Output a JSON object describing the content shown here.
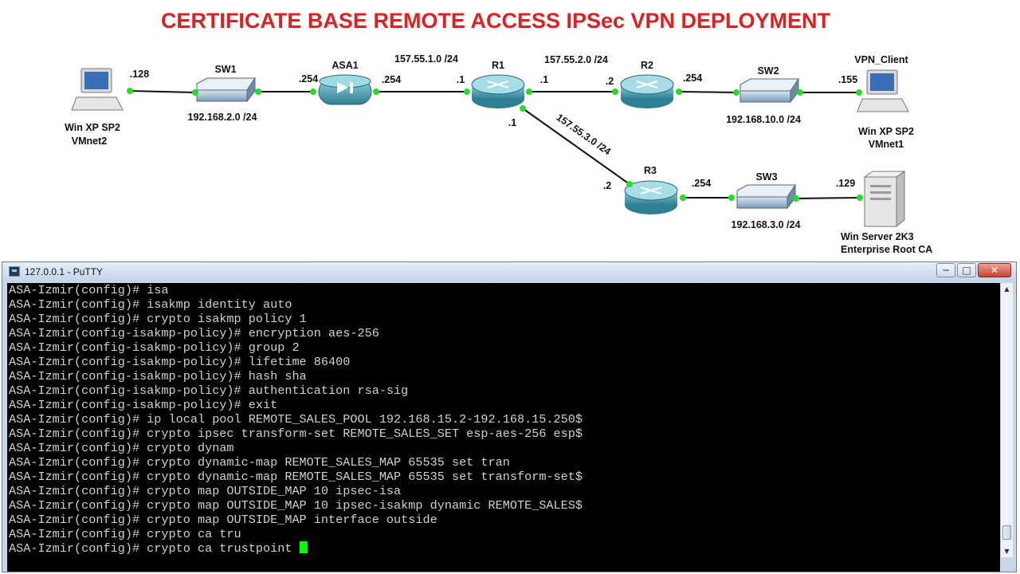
{
  "diagram": {
    "title": "CERTIFICATE BASE REMOTE ACCESS IPSec VPN DEPLOYMENT",
    "devices": {
      "sw1": "SW1",
      "asa1": "ASA1",
      "r1": "R1",
      "r2": "R2",
      "r3": "R3",
      "sw2": "SW2",
      "sw3": "SW3",
      "vpn_client": "VPN_Client"
    },
    "hosts": {
      "left_pc": [
        "Win XP SP2",
        "VMnet2"
      ],
      "right_pc": [
        "Win XP SP2",
        "VMnet1"
      ],
      "server": [
        "Win Server 2K3",
        "Enterprise Root CA"
      ]
    },
    "networks": {
      "lan_left": "192.168.2.0 /24",
      "asa_r1": "157.55.1.0 /24",
      "r1_r2": "157.55.2.0 /24",
      "r1_r3": "157.55.3.0 /24",
      "lan_r2": "192.168.10.0 /24",
      "lan_r3": "192.168.3.0 /24"
    },
    "ports": {
      "pc_left": ".128",
      "asa_in": ".254",
      "asa_out": ".254",
      "r1_e": ".1",
      "r1_w": ".1",
      "r1_s": ".1",
      "r2_w": ".2",
      "r2_e": ".254",
      "vpn_client": ".155",
      "r3_n": ".2",
      "r3_e": ".254",
      "server": ".129"
    },
    "colors": {
      "title": "#e02020",
      "link_dot": "#22dd22"
    }
  },
  "window": {
    "title": "127.0.0.1 - PuTTY",
    "icon": "putty-icon",
    "controls": {
      "minimize": "─",
      "maximize": "□",
      "close": "✕"
    }
  },
  "terminal": {
    "lines": [
      "ASA-Izmir(config)# isa",
      "ASA-Izmir(config)# isakmp identity auto",
      "ASA-Izmir(config)# crypto isakmp policy 1",
      "ASA-Izmir(config-isakmp-policy)# encryption aes-256",
      "ASA-Izmir(config-isakmp-policy)# group 2",
      "ASA-Izmir(config-isakmp-policy)# lifetime 86400",
      "ASA-Izmir(config-isakmp-policy)# hash sha",
      "ASA-Izmir(config-isakmp-policy)# authentication rsa-sig",
      "ASA-Izmir(config-isakmp-policy)# exit",
      "ASA-Izmir(config)# ip local pool REMOTE_SALES_POOL 192.168.15.2-192.168.15.250$",
      "ASA-Izmir(config)# crypto ipsec transform-set REMOTE_SALES_SET esp-aes-256 esp$",
      "ASA-Izmir(config)# crypto dynam",
      "ASA-Izmir(config)# crypto dynamic-map REMOTE_SALES_MAP 65535 set tran",
      "ASA-Izmir(config)# crypto dynamic-map REMOTE_SALES_MAP 65535 set transform-set$",
      "ASA-Izmir(config)# crypto map OUTSIDE_MAP 10 ipsec-isa",
      "ASA-Izmir(config)# crypto map OUTSIDE_MAP 10 ipsec-isakmp dynamic REMOTE_SALES$",
      "ASA-Izmir(config)# crypto map OUTSIDE_MAP interface outside",
      "ASA-Izmir(config)# crypto ca tru"
    ],
    "current_line": "ASA-Izmir(config)# crypto ca trustpoint ",
    "cursor_color": "#00ff00"
  }
}
